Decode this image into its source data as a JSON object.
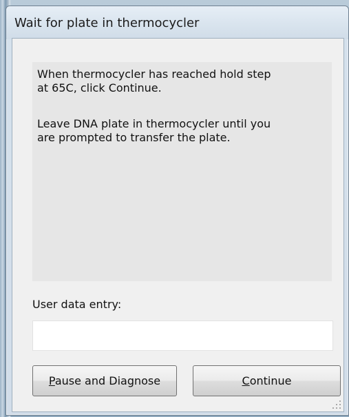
{
  "window": {
    "title": "Wait for plate in thermocycler"
  },
  "message": {
    "lines": [
      "When thermocycler has reached hold step",
      "at 65C, click Continue.",
      "",
      "Leave DNA plate in thermocycler until you",
      "are prompted to transfer the plate."
    ]
  },
  "user_data": {
    "label": "User data entry:",
    "value": "",
    "placeholder": ""
  },
  "buttons": {
    "pause": {
      "mnemonic": "P",
      "rest": "ause and Diagnose"
    },
    "continue": {
      "mnemonic": "C",
      "rest": "ontinue"
    }
  },
  "colors": {
    "client_background": "#f0f0f0",
    "message_panel": "#e6e6e6",
    "title_bar": "#d9e4ee"
  }
}
